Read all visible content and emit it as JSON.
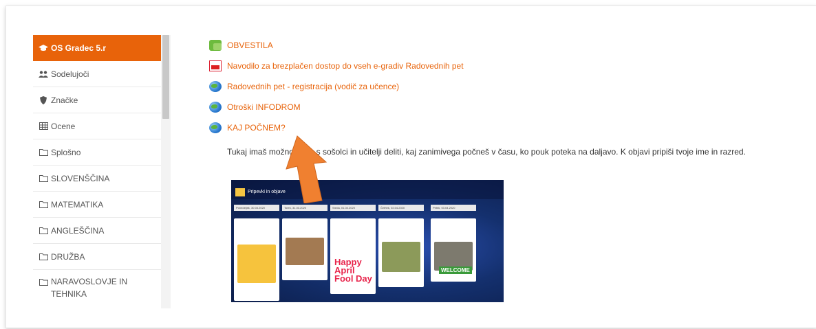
{
  "sidebar": {
    "items": [
      {
        "label": "OS Gradec 5.r",
        "icon": "graduation-cap-icon",
        "active": true
      },
      {
        "label": "Sodelujoči",
        "icon": "users-icon"
      },
      {
        "label": "Značke",
        "icon": "shield-icon"
      },
      {
        "label": "Ocene",
        "icon": "table-icon"
      },
      {
        "label": "Splošno",
        "icon": "folder-icon"
      },
      {
        "label": "SLOVENŠČINA",
        "icon": "folder-icon"
      },
      {
        "label": "MATEMATIKA",
        "icon": "folder-icon"
      },
      {
        "label": "ANGLEŠČINA",
        "icon": "folder-icon"
      },
      {
        "label": "DRUŽBA",
        "icon": "folder-icon"
      },
      {
        "label": "NARAVOSLOVJE IN TEHNIKA",
        "icon": "folder-icon"
      }
    ]
  },
  "content": {
    "links": [
      {
        "label": "OBVESTILA",
        "icon": "forum-icon"
      },
      {
        "label": "Navodilo za brezplačen dostop do vseh e-gradiv Radovednih pet",
        "icon": "pdf-icon"
      },
      {
        "label": "Radovednih pet - registracija (vodič za učence)",
        "icon": "url-icon"
      },
      {
        "label": "Otroški INFODROM",
        "icon": "url-icon"
      },
      {
        "label": "KAJ POČNEM?",
        "icon": "url-icon"
      }
    ],
    "description": "Tukaj imaš možnost, da s sošolci in učitelji deliti, kaj zanimivega počneš v času, ko pouk poteka na daljavo. K objavi pripiši tvoje ime in razred.",
    "board": {
      "title": "Pripevki in objave",
      "columns": [
        "Ponedeljek, 30.03.2020",
        "Torek, 31.03.2020",
        "Sreda, 01.04.2020",
        "Četrtek, 02.04.2020",
        "Petek, 03.04.2020"
      ],
      "card_text": "Happy April Fool Day",
      "card_welcome": "WELCOME"
    }
  },
  "colors": {
    "accent": "#e8630a",
    "arrow": "#f08030"
  }
}
